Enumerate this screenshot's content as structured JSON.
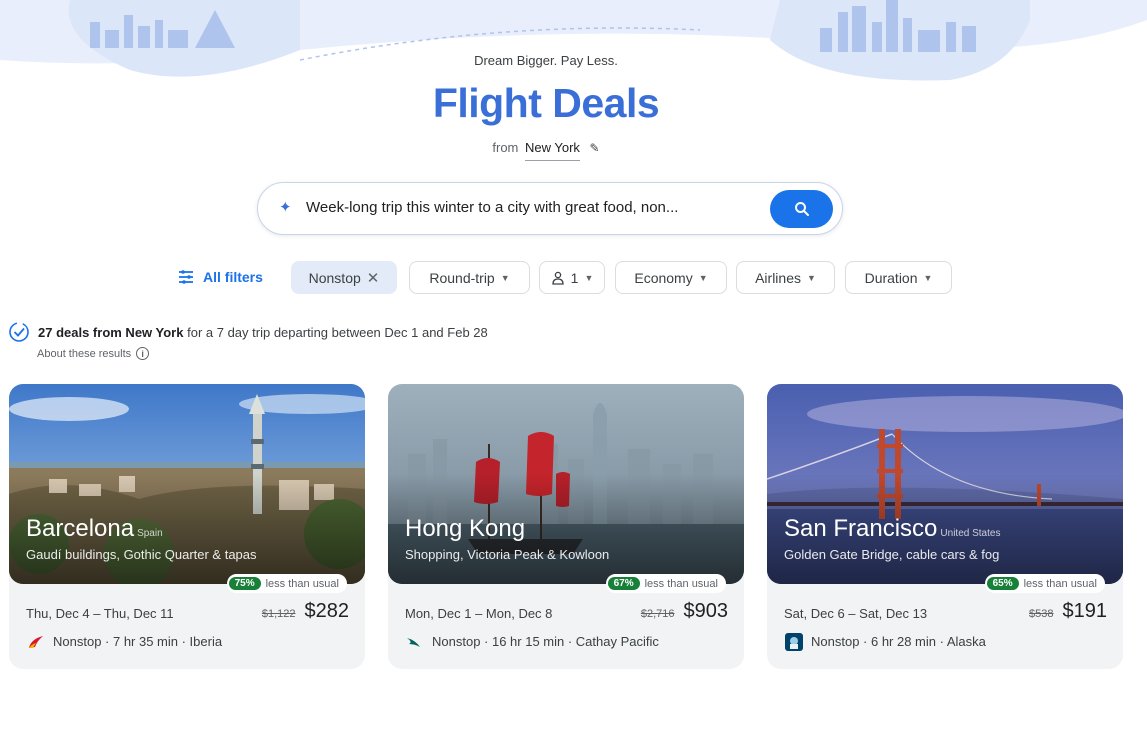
{
  "header": {
    "tagline": "Dream Bigger. Pay Less.",
    "title": "Flight Deals",
    "from_prefix": "from",
    "from_city": "New York"
  },
  "search": {
    "value": "Week-long trip this winter to a city with great food, non..."
  },
  "filters": {
    "all_filters": "All filters",
    "chips": [
      {
        "label": "Nonstop",
        "active": true
      },
      {
        "label": "Round-trip"
      },
      {
        "label": "1"
      },
      {
        "label": "Economy"
      },
      {
        "label": "Airlines"
      },
      {
        "label": "Duration"
      }
    ]
  },
  "results": {
    "count_text": "27 deals from New York",
    "rest_text": "for a 7 day trip departing between Dec 1 and Feb 28",
    "about": "About these results"
  },
  "deals": [
    {
      "city": "Barcelona",
      "country": "Spain",
      "desc": "Gaudí buildings, Gothic Quarter & tapas",
      "pct": "75%",
      "badge_text": "less than usual",
      "dates": "Thu, Dec 4 – Thu, Dec 11",
      "old_price": "$1,122",
      "price": "$282",
      "flight": "Nonstop · 7 hr 35 min · Iberia",
      "airline_icon": "iberia-logo-icon",
      "colors": {
        "sky_top": "#3f78c9",
        "sky_bottom": "#a9c9ea"
      }
    },
    {
      "city": "Hong Kong",
      "country": "",
      "desc": "Shopping, Victoria Peak & Kowloon",
      "pct": "67%",
      "badge_text": "less than usual",
      "dates": "Mon, Dec 1 – Mon, Dec 8",
      "old_price": "$2,716",
      "price": "$903",
      "flight": "Nonstop · 16 hr 15 min · Cathay Pacific",
      "airline_icon": "cathay-logo-icon",
      "colors": {
        "sky_top": "#9fb0bd",
        "sky_bottom": "#6f828f"
      }
    },
    {
      "city": "San Francisco",
      "country": "United States",
      "desc": "Golden Gate Bridge, cable cars & fog",
      "pct": "65%",
      "badge_text": "less than usual",
      "dates": "Sat, Dec 6 – Sat, Dec 13",
      "old_price": "$538",
      "price": "$191",
      "flight": "Nonstop · 6 hr 28 min · Alaska",
      "airline_icon": "alaska-logo-icon",
      "colors": {
        "sky_top": "#4a5fb0",
        "sky_bottom": "#8c8fc8"
      }
    }
  ],
  "colors": {
    "accent": "#1a73e8",
    "title": "#3b6fd8",
    "badge_green": "#188038"
  }
}
